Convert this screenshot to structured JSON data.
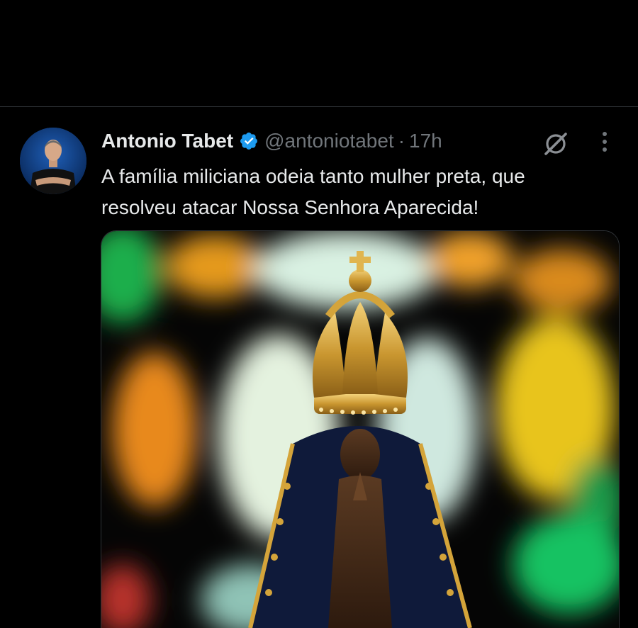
{
  "tweet": {
    "author": {
      "display_name": "Antonio Tabet",
      "handle": "@antoniotabet",
      "verified": true
    },
    "separator": "·",
    "time_ago": "17h",
    "text_lines": [
      "A família miliciana odeia tanto mulher preta, que",
      "resolveu atacar Nossa Senhora Aparecida!"
    ],
    "media": {
      "subject": "statue of Nossa Senhora Aparecida with golden crown and dark mantle"
    }
  },
  "icons": {
    "verified": "verified-badge-icon",
    "grok": "grok-icon",
    "more": "more-vertical-icon"
  },
  "colors": {
    "background": "#000000",
    "text_primary": "#e7e9ea",
    "text_secondary": "#71767b",
    "verified_blue": "#1d9bf0",
    "divider": "#2f3336"
  }
}
